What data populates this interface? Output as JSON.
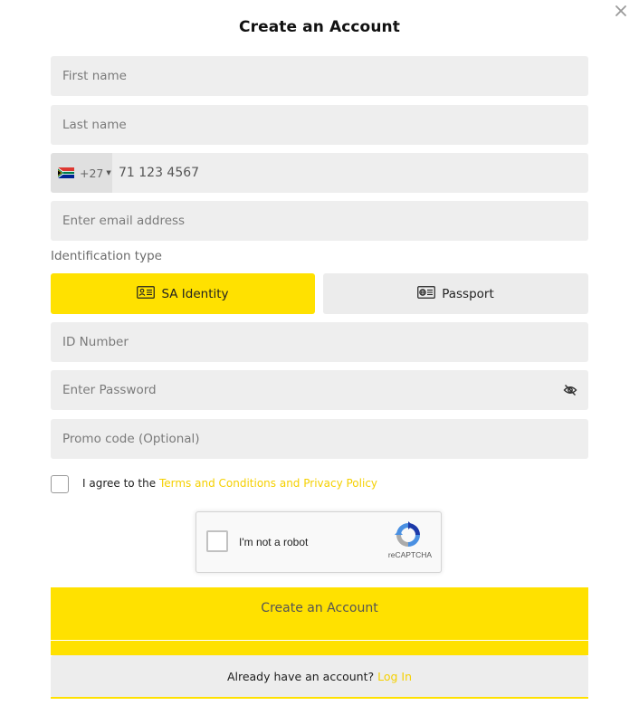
{
  "modal": {
    "title": "Create an Account",
    "close_icon": "close-icon"
  },
  "form": {
    "first_name_placeholder": "First name",
    "last_name_placeholder": "Last name",
    "phone": {
      "country_flag": "south-africa-flag-icon",
      "country_code": "+27",
      "placeholder": "71 123 4567"
    },
    "email_placeholder": "Enter email address",
    "id_type": {
      "label": "Identification type",
      "options": [
        {
          "label": "SA Identity",
          "icon": "id-card-icon",
          "selected": true
        },
        {
          "label": "Passport",
          "icon": "passport-icon",
          "selected": false
        }
      ]
    },
    "id_number_placeholder": "ID Number",
    "password_placeholder": "Enter Password",
    "password_toggle_icon": "eye-slash-icon",
    "promo_placeholder": "Promo code (Optional)",
    "agree_prefix": "I agree to the",
    "agree_link": "Terms and Conditions and Privacy Policy",
    "agree_checked": false
  },
  "recaptcha": {
    "label": "I'm not a robot",
    "brand": "reCAPTCHA",
    "checked": false
  },
  "actions": {
    "submit_label": "Create an Account",
    "login_prompt": "Already have an account?",
    "login_link": "Log In"
  },
  "colors": {
    "accent": "#ffe100",
    "link": "#f5d000",
    "field_bg": "#eeeeee"
  }
}
